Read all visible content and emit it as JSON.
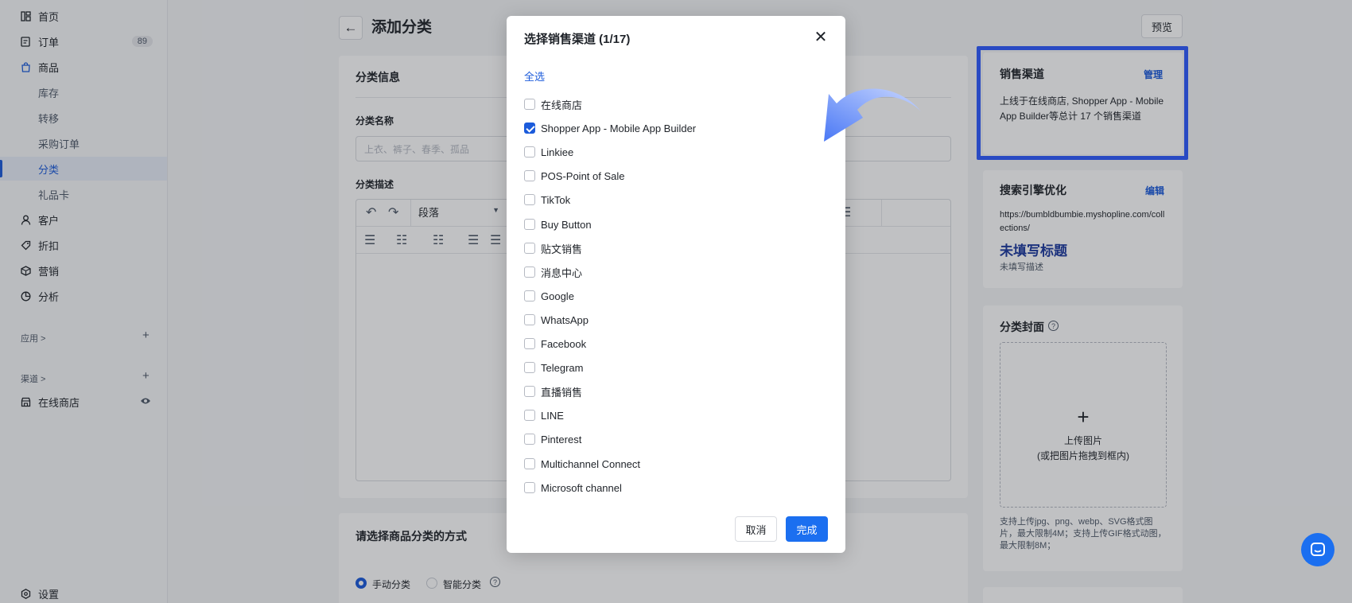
{
  "sidebar": {
    "items": [
      {
        "label": "首页",
        "icon": "home-grid-icon"
      },
      {
        "label": "订单",
        "icon": "order-icon",
        "badge": "89"
      },
      {
        "label": "商品",
        "icon": "shopping-bag-icon"
      },
      {
        "label": "库存"
      },
      {
        "label": "转移"
      },
      {
        "label": "采购订单"
      },
      {
        "label": "分类"
      },
      {
        "label": "礼品卡"
      },
      {
        "label": "客户",
        "icon": "user-icon"
      },
      {
        "label": "折扣",
        "icon": "tag-icon"
      },
      {
        "label": "营销",
        "icon": "cube-icon"
      },
      {
        "label": "分析",
        "icon": "pie-chart-icon"
      }
    ],
    "apps_label": "应用 >",
    "channels_label": "渠道 >",
    "online_store": "在线商店",
    "settings": "设置"
  },
  "header": {
    "title": "添加分类",
    "preview": "预览"
  },
  "main": {
    "info_title": "分类信息",
    "name_label": "分类名称",
    "name_placeholder": "上衣、裤子、春季、孤品",
    "desc_label": "分类描述",
    "paragraph": "段落",
    "method_title": "请选择商品分类的方式",
    "manual": "手动分类",
    "smart": "智能分类"
  },
  "right": {
    "channels_title": "销售渠道",
    "manage": "管理",
    "channels_desc": "上线于在线商店, Shopper App - Mobile App Builder等总计 17 个销售渠道",
    "seo_title": "搜索引擎优化",
    "edit": "编辑",
    "seo_url": "https://bumbldbumbie.myshopline.com/collections/",
    "seo_heading": "未填写标题",
    "seo_desc": "未填写描述",
    "cover_title": "分类封面",
    "upload_line1": "上传图片",
    "upload_line2": "(或把图片拖拽到框内)",
    "upload_hint": "支持上传jpg、png、webp、SVG格式图片，最大限制4M；支持上传GIF格式动图，最大限制8M；"
  },
  "modal": {
    "title": "选择销售渠道 (1/17)",
    "select_all": "全选",
    "channels": [
      {
        "label": "在线商店",
        "checked": false
      },
      {
        "label": "Shopper App - Mobile App Builder",
        "checked": true
      },
      {
        "label": "Linkiee",
        "checked": false
      },
      {
        "label": "POS-Point of Sale",
        "checked": false
      },
      {
        "label": "TikTok",
        "checked": false
      },
      {
        "label": "Buy Button",
        "checked": false
      },
      {
        "label": "贴文销售",
        "checked": false
      },
      {
        "label": "消息中心",
        "checked": false
      },
      {
        "label": "Google",
        "checked": false
      },
      {
        "label": "WhatsApp",
        "checked": false
      },
      {
        "label": "Facebook",
        "checked": false
      },
      {
        "label": "Telegram",
        "checked": false
      },
      {
        "label": "直播销售",
        "checked": false
      },
      {
        "label": "LINE",
        "checked": false
      },
      {
        "label": "Pinterest",
        "checked": false
      },
      {
        "label": "Multichannel Connect",
        "checked": false
      },
      {
        "label": "Microsoft channel",
        "checked": false
      }
    ],
    "cancel": "取消",
    "done": "完成"
  },
  "colors": {
    "primary": "#1b6ff0",
    "link": "#1b5bdb",
    "highlight": "#2f5bff"
  }
}
